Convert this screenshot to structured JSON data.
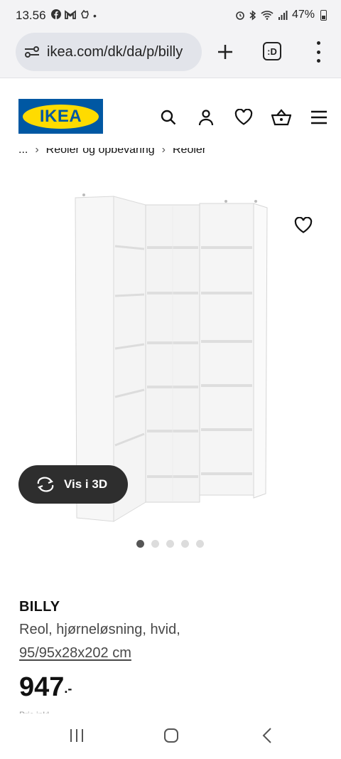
{
  "status_bar": {
    "time": "13.56",
    "battery": "47%",
    "icons": [
      "facebook-icon",
      "gmail-icon",
      "notification-icon",
      "dot-icon",
      "alarm-icon",
      "bluetooth-icon",
      "wifi-icon",
      "signal-icon",
      "battery-icon"
    ]
  },
  "browser": {
    "url": "ikea.com/dk/da/p/billy",
    "tabs_label": ":D"
  },
  "header": {
    "logo_text": "IKEA",
    "icons": [
      "search-icon",
      "profile-icon",
      "heart-icon",
      "basket-icon",
      "menu-icon"
    ]
  },
  "breadcrumb": {
    "items": [
      "...",
      "Reoler og opbevaring",
      "Reoler"
    ],
    "separator": "›"
  },
  "gallery": {
    "view3d_label": "Vis i 3D",
    "dots_total": 5,
    "active_dot_index": 0
  },
  "product": {
    "name": "BILLY",
    "description": "Reol, hjørneløsning, hvid,",
    "dimensions": "95/95x28x202 cm",
    "price": "947",
    "price_suffix": ".-",
    "partial_line": "Pris inkl. moms"
  },
  "colors": {
    "ikea_blue": "#0058a3",
    "ikea_yellow": "#ffdb00",
    "browser_bg": "#f3f3f5",
    "url_pill": "#e2e4ea",
    "view3d_bg": "#2e2e2e"
  }
}
